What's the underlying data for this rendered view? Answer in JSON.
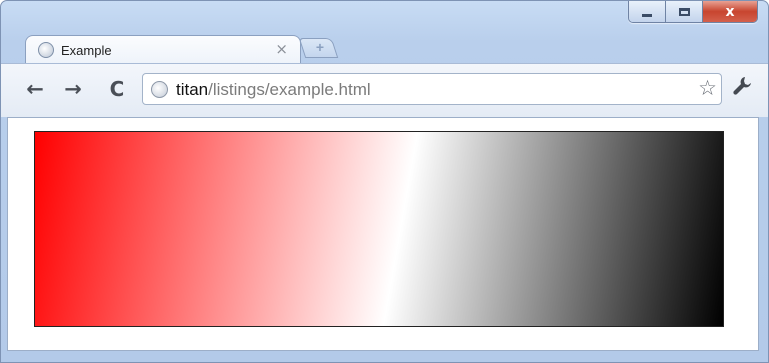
{
  "tab": {
    "title": "Example",
    "close_glyph": "×",
    "favicon": "globe-icon"
  },
  "new_tab": {
    "glyph": "+"
  },
  "window_controls": {
    "minimize": "minimize-icon",
    "maximize": "maximize-icon",
    "close": "x"
  },
  "toolbar": {
    "back_glyph": "←",
    "forward_glyph": "→",
    "reload_glyph": "C",
    "url_host": "titan",
    "url_path": "/listings/example.html",
    "star_glyph": "☆",
    "wrench_glyph": "🔧"
  },
  "canvas": {
    "gradient_colors": [
      "#ff0000",
      "#ffffff",
      "#000000"
    ]
  }
}
